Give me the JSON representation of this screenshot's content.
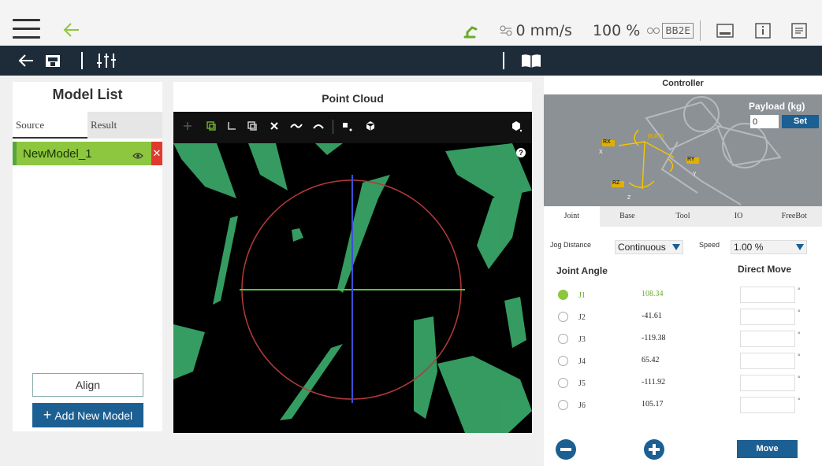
{
  "status_bar": {
    "speed": "0 mm/s",
    "percentage": "100 %",
    "controller_id": "BB2E"
  },
  "model_list": {
    "title": "Model List",
    "tabs": [
      "Source",
      "Result"
    ],
    "items": [
      {
        "label": "NewModel_1"
      }
    ],
    "align_label": "Align",
    "add_label": "Add New Model"
  },
  "point_cloud": {
    "title": "Point Cloud"
  },
  "controller": {
    "title": "Controller",
    "payload_label": "Payload (kg)",
    "payload_value": "0",
    "set_label": "Set",
    "axis_labels": [
      "RX",
      "RY",
      "RZ",
      "X",
      "Y",
      "Z",
      "(0,0,0)"
    ],
    "tabs": [
      "Joint",
      "Base",
      "Tool",
      "IO",
      "FreeBot"
    ],
    "jog_distance_label": "Jog Distance",
    "jog_distance_value": "Continuous",
    "speed_label": "Speed",
    "speed_value": "1.00 %",
    "joint_angle_label": "Joint Angle",
    "direct_move_label": "Direct Move",
    "degree_symbol": "°",
    "joints": [
      {
        "name": "J1",
        "value": "108.34"
      },
      {
        "name": "J2",
        "value": "-41.61"
      },
      {
        "name": "J3",
        "value": "-119.38"
      },
      {
        "name": "J4",
        "value": "65.42"
      },
      {
        "name": "J5",
        "value": "-111.92"
      },
      {
        "name": "J6",
        "value": "105.17"
      }
    ],
    "move_label": "Move"
  },
  "colors": {
    "accent_blue": "#1c5f93",
    "accent_green": "#8dc63f",
    "toolbar_dark": "#1e2c3a",
    "delete_red": "#e0392d"
  }
}
